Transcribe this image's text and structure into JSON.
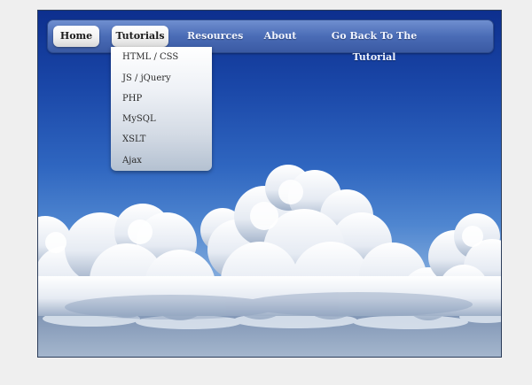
{
  "nav": {
    "items": [
      {
        "label": "Home"
      },
      {
        "label": "Tutorials"
      },
      {
        "label": "Resources"
      },
      {
        "label": "About"
      },
      {
        "label": "Go Back To The Tutorial"
      }
    ]
  },
  "dropdown": {
    "items": [
      {
        "label": "HTML / CSS"
      },
      {
        "label": "JS / jQuery"
      },
      {
        "label": "PHP"
      },
      {
        "label": "MySQL"
      },
      {
        "label": "XSLT"
      },
      {
        "label": "Ajax"
      }
    ]
  },
  "colors": {
    "menubar": "#4a6cb6",
    "sky_top": "#0d2f8e",
    "page_background": "#efefef"
  }
}
